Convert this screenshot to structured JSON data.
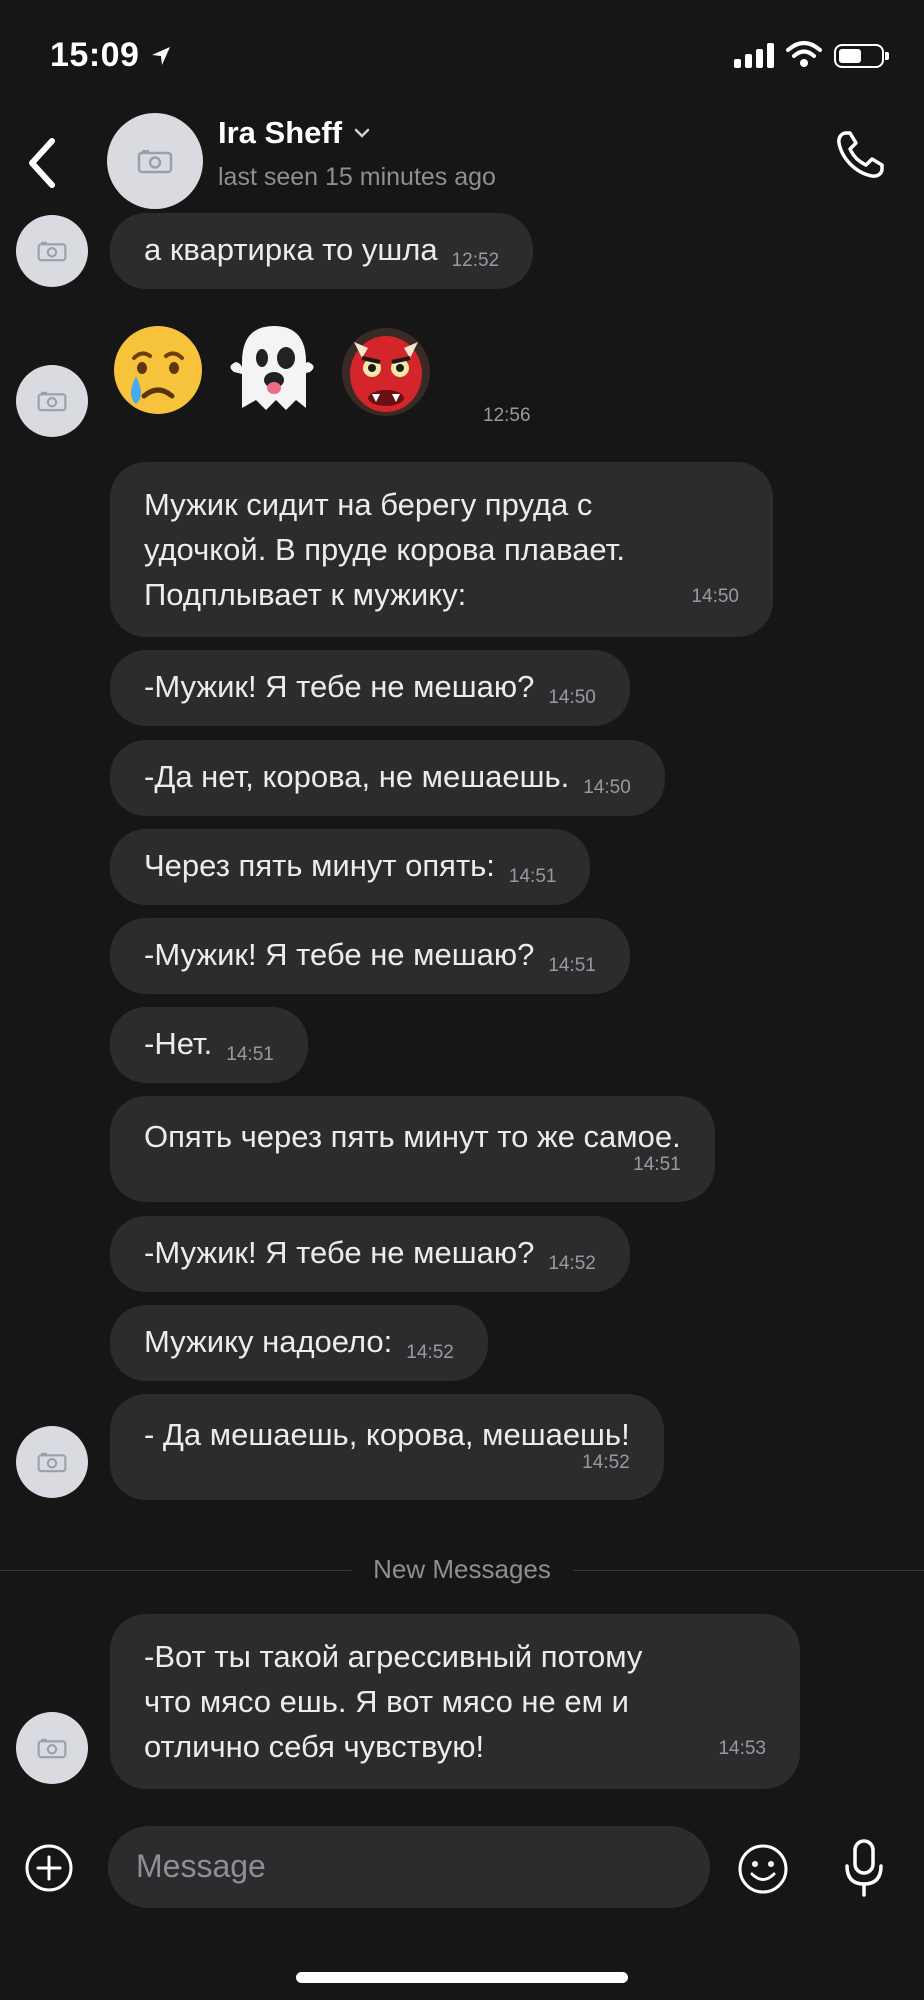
{
  "status_bar": {
    "time": "15:09"
  },
  "header": {
    "contact_name": "Ira Sheff",
    "status": "last seen 15 minutes ago"
  },
  "messages": [
    {
      "text": "а квартирка то ушла",
      "time": "12:52"
    },
    {
      "text": "Мужик сидит на берегу пруда с\nудочкой. В пруде корова плавает.\nПодплывает к мужику:",
      "time": "14:50"
    },
    {
      "text": "-Мужик! Я тебе не мешаю?",
      "time": "14:50"
    },
    {
      "text": "-Да нет, корова, не мешаешь.",
      "time": "14:50"
    },
    {
      "text": "Через пять минут опять:",
      "time": "14:51"
    },
    {
      "text": "-Мужик! Я тебе не мешаю?",
      "time": "14:51"
    },
    {
      "text": "-Нет.",
      "time": "14:51"
    },
    {
      "text": "Опять через пять минут то же самое.",
      "time": "14:51"
    },
    {
      "text": "-Мужик! Я тебе не мешаю?",
      "time": "14:52"
    },
    {
      "text": "Мужику надоело:",
      "time": "14:52"
    },
    {
      "text": "- Да мешаешь, корова, мешаешь!",
      "time": "14:52"
    },
    {
      "text": "-Вот ты такой агрессивный потому\nчто мясо ешь. Я вот мясо не ем и\nотлично себя чувствую!",
      "time": "14:53"
    }
  ],
  "emoji_message": {
    "emojis": [
      "crying-face",
      "ghost",
      "ogre"
    ],
    "time": "12:56"
  },
  "divider": {
    "label": "New Messages"
  },
  "composer": {
    "placeholder": "Message"
  },
  "icons": {
    "back": "chevron-left-icon",
    "call": "phone-icon",
    "attach": "plus-circle-icon",
    "emoji": "smiley-icon",
    "mic": "microphone-icon"
  }
}
